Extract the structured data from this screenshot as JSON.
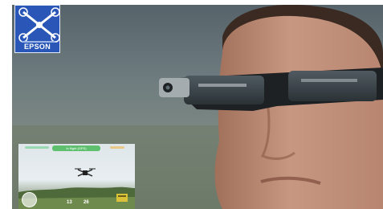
{
  "app": {
    "brand": "EPSON"
  },
  "inset": {
    "flight_status": "In flight (GPS)",
    "readout_altitude": "13",
    "readout_distance": "26"
  },
  "colors": {
    "badge_blue": "#2a56b8",
    "status_green": "#5ec06e",
    "landscape_green": "#5f7447"
  },
  "icons": [
    "drone-icon",
    "joystick-icon",
    "home-marker-icon"
  ]
}
